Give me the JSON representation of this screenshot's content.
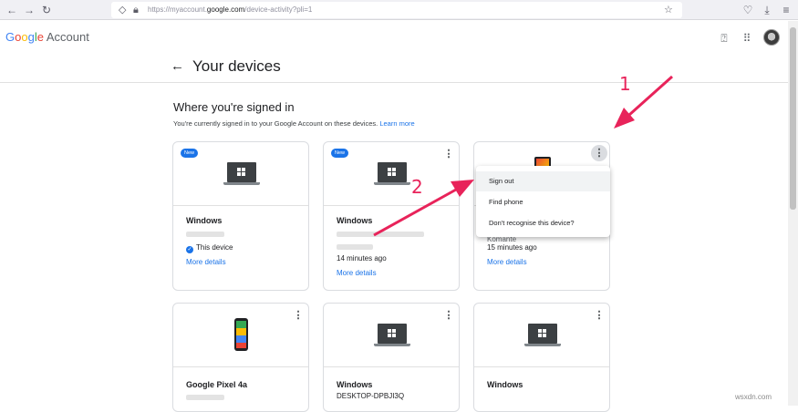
{
  "browser": {
    "url_prefix": "https://myaccount.",
    "url_domain": "google.com",
    "url_suffix": "/device-activity?pli=1"
  },
  "header": {
    "logo_google": [
      "G",
      "o",
      "o",
      "g",
      "l",
      "e"
    ],
    "logo_account": "Account",
    "back_icon": "arrow-left-icon",
    "title": "Your devices"
  },
  "section": {
    "title": "Where you're signed in",
    "subtitle": "You're currently signed in to your Google Account on these devices.",
    "learn_more": "Learn more"
  },
  "devices": [
    {
      "badge": "New",
      "name": "Windows",
      "status": "This device",
      "details": "More details",
      "icon": "windows-laptop-icon"
    },
    {
      "badge": "New",
      "name": "Windows",
      "time": "14 minutes ago",
      "details": "More details",
      "icon": "windows-laptop-icon"
    },
    {
      "name": "Komante",
      "time": "15 minutes ago",
      "details": "More details",
      "icon": "phone-icon"
    },
    {
      "name": "Google Pixel 4a",
      "icon": "pixel-phone-icon"
    },
    {
      "name": "Windows",
      "sub": "DESKTOP-DPBJI3Q",
      "icon": "windows-laptop-icon"
    },
    {
      "name": "Windows",
      "icon": "windows-laptop-icon"
    }
  ],
  "menu": {
    "items": [
      "Sign out",
      "Find phone",
      "Don't recognise this device?"
    ]
  },
  "annotations": {
    "one": "1",
    "two": "2",
    "color": "#e8235a"
  },
  "watermark": "wsxdn.com",
  "colors": {
    "accent": "#1a73e8",
    "annotation": "#e8235a"
  }
}
